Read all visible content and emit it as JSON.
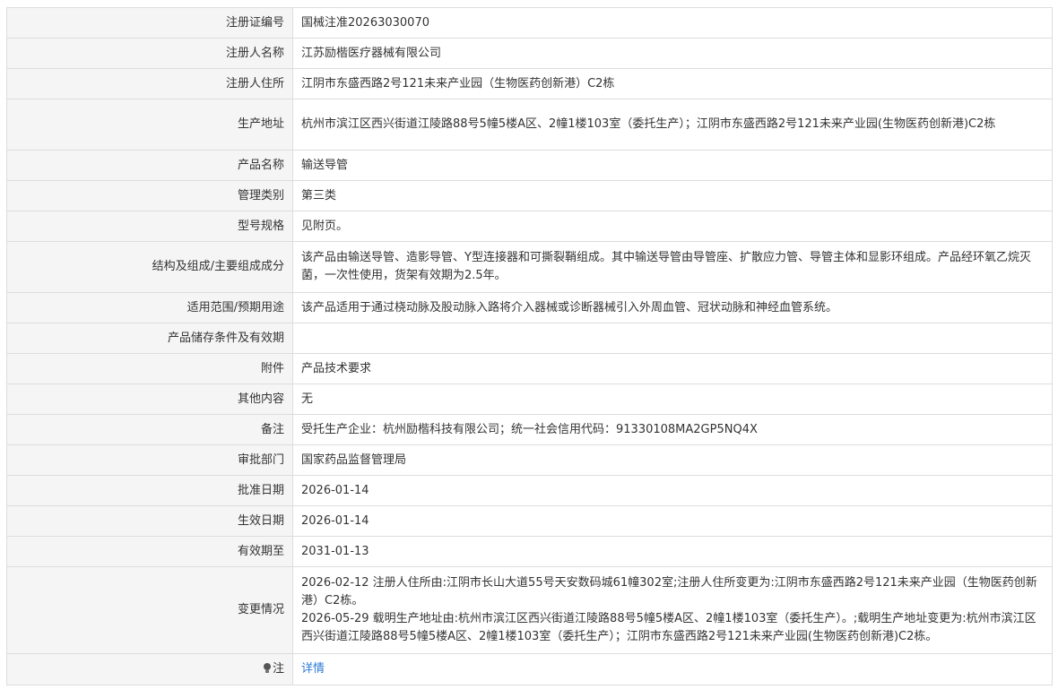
{
  "rows": [
    {
      "label": "注册证编号",
      "value": "国械注准20263030070"
    },
    {
      "label": "注册人名称",
      "value": "江苏励楷医疗器械有限公司"
    },
    {
      "label": "注册人住所",
      "value": "江阴市东盛西路2号121未来产业园（生物医药创新港）C2栋"
    },
    {
      "label": "生产地址",
      "value": "杭州市滨江区西兴街道江陵路88号5幢5楼A区、2幢1楼103室（委托生产）；江阴市东盛西路2号121未来产业园(生物医药创新港)C2栋"
    },
    {
      "label": "产品名称",
      "value": "输送导管"
    },
    {
      "label": "管理类别",
      "value": "第三类"
    },
    {
      "label": "型号规格",
      "value": "见附页。"
    },
    {
      "label": "结构及组成/主要组成成分",
      "value": "该产品由输送导管、造影导管、Y型连接器和可撕裂鞘组成。其中输送导管由导管座、扩散应力管、导管主体和显影环组成。产品经环氧乙烷灭菌，一次性使用，货架有效期为2.5年。"
    },
    {
      "label": "适用范围/预期用途",
      "value": "该产品适用于通过桡动脉及股动脉入路将介入器械或诊断器械引入外周血管、冠状动脉和神经血管系统。"
    },
    {
      "label": "产品储存条件及有效期",
      "value": ""
    },
    {
      "label": "附件",
      "value": "产品技术要求"
    },
    {
      "label": "其他内容",
      "value": "无"
    },
    {
      "label": "备注",
      "value": "受托生产企业：杭州励楷科技有限公司；统一社会信用代码：91330108MA2GP5NQ4X"
    },
    {
      "label": "审批部门",
      "value": "国家药品监督管理局"
    },
    {
      "label": "批准日期",
      "value": "2026-01-14"
    },
    {
      "label": "生效日期",
      "value": "2026-01-14"
    },
    {
      "label": "有效期至",
      "value": "2031-01-13"
    }
  ],
  "changes": {
    "label": "变更情况",
    "entries": [
      "2026-02-12 注册人住所由:江阴市长山大道55号天安数码城61幢302室;注册人住所变更为:江阴市东盛西路2号121未来产业园（生物医药创新港）C2栋。",
      "2026-05-29 载明生产地址由:杭州市滨江区西兴街道江陵路88号5幢5楼A区、2幢1楼103室（委托生产）。;载明生产地址变更为:杭州市滨江区西兴街道江陵路88号5幢5楼A区、2幢1楼103室（委托生产）；江阴市东盛西路2号121未来产业园(生物医药创新港)C2栋。"
    ]
  },
  "note": {
    "icon": "lightbulb-icon",
    "label": "注",
    "link_text": "详情",
    "link_color": "#2a7bd5"
  }
}
